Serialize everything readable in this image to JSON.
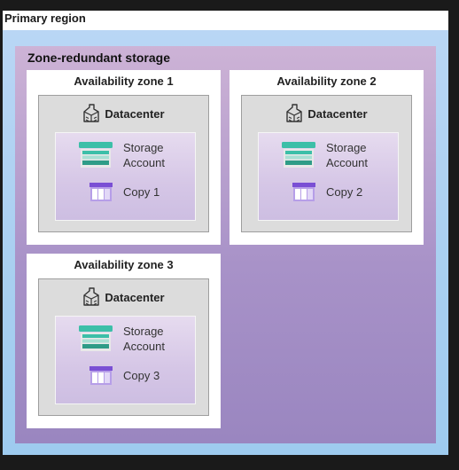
{
  "region": {
    "title": "Primary region"
  },
  "zrs": {
    "title": "Zone-redundant storage"
  },
  "zones": [
    {
      "title": "Availability zone 1",
      "datacenter": "Datacenter",
      "storage_line1": "Storage",
      "storage_line2": "Account",
      "copy": "Copy 1"
    },
    {
      "title": "Availability zone 2",
      "datacenter": "Datacenter",
      "storage_line1": "Storage",
      "storage_line2": "Account",
      "copy": "Copy 2"
    },
    {
      "title": "Availability zone 3",
      "datacenter": "Datacenter",
      "storage_line1": "Storage",
      "storage_line2": "Account",
      "copy": "Copy 3"
    }
  ],
  "icons": {
    "datacenter": "datacenter-icon",
    "storage_account": "storage-account-icon",
    "copy": "storage-copy-icon"
  },
  "colors": {
    "region_fill": "#a8cff0",
    "zrs_fill": "#a892c8",
    "storage_teal": "#3cbfa8",
    "copy_purple": "#7a4fd4"
  }
}
